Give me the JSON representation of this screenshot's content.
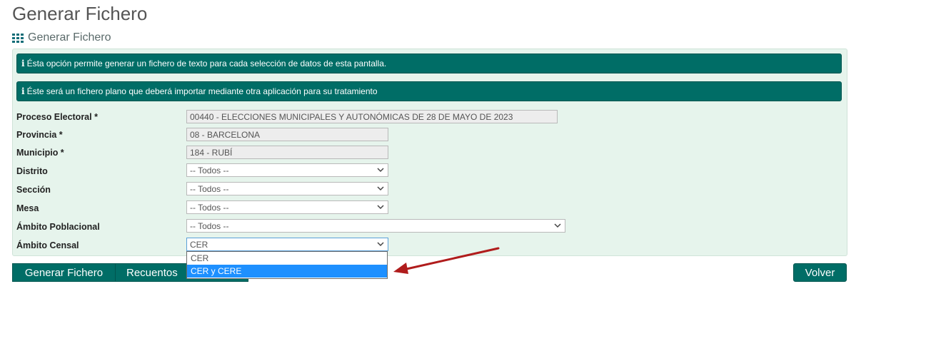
{
  "page": {
    "title": "Generar Fichero"
  },
  "section": {
    "title": "Generar Fichero",
    "icon": "grid-icon"
  },
  "info": [
    {
      "text": "Ésta opción permite generar un fichero de texto para cada selección de datos de esta pantalla."
    },
    {
      "text": "Éste será un fichero plano que deberá importar mediante otra aplicación para su tratamiento"
    }
  ],
  "form": {
    "proceso": {
      "label": "Proceso Electoral *",
      "value": "00440 - ELECCIONES MUNICIPALES Y AUTONÓMICAS DE 28 DE MAYO DE 2023"
    },
    "provincia": {
      "label": "Provincia *",
      "value": "08 - BARCELONA"
    },
    "municipio": {
      "label": "Municipio *",
      "value": "184 - RUBÍ"
    },
    "distrito": {
      "label": "Distrito",
      "value": "-- Todos --"
    },
    "seccion": {
      "label": "Sección",
      "value": "-- Todos --"
    },
    "mesa": {
      "label": "Mesa",
      "value": "-- Todos --"
    },
    "ambito_poblacional": {
      "label": "Ámbito Poblacional",
      "value": "-- Todos --"
    },
    "ambito_censal": {
      "label": "Ámbito Censal",
      "value": "CER",
      "options": [
        "CER",
        "CER y CERE"
      ],
      "highlighted": "CER y CERE"
    }
  },
  "buttons": {
    "generar": "Generar Fichero",
    "recuentos": "Recuentos",
    "volver": "Volver"
  },
  "colors": {
    "primary": "#006d66",
    "panel_bg": "#e6f4ec",
    "highlight": "#1e90ff",
    "annotation_arrow": "#b01c1c"
  }
}
